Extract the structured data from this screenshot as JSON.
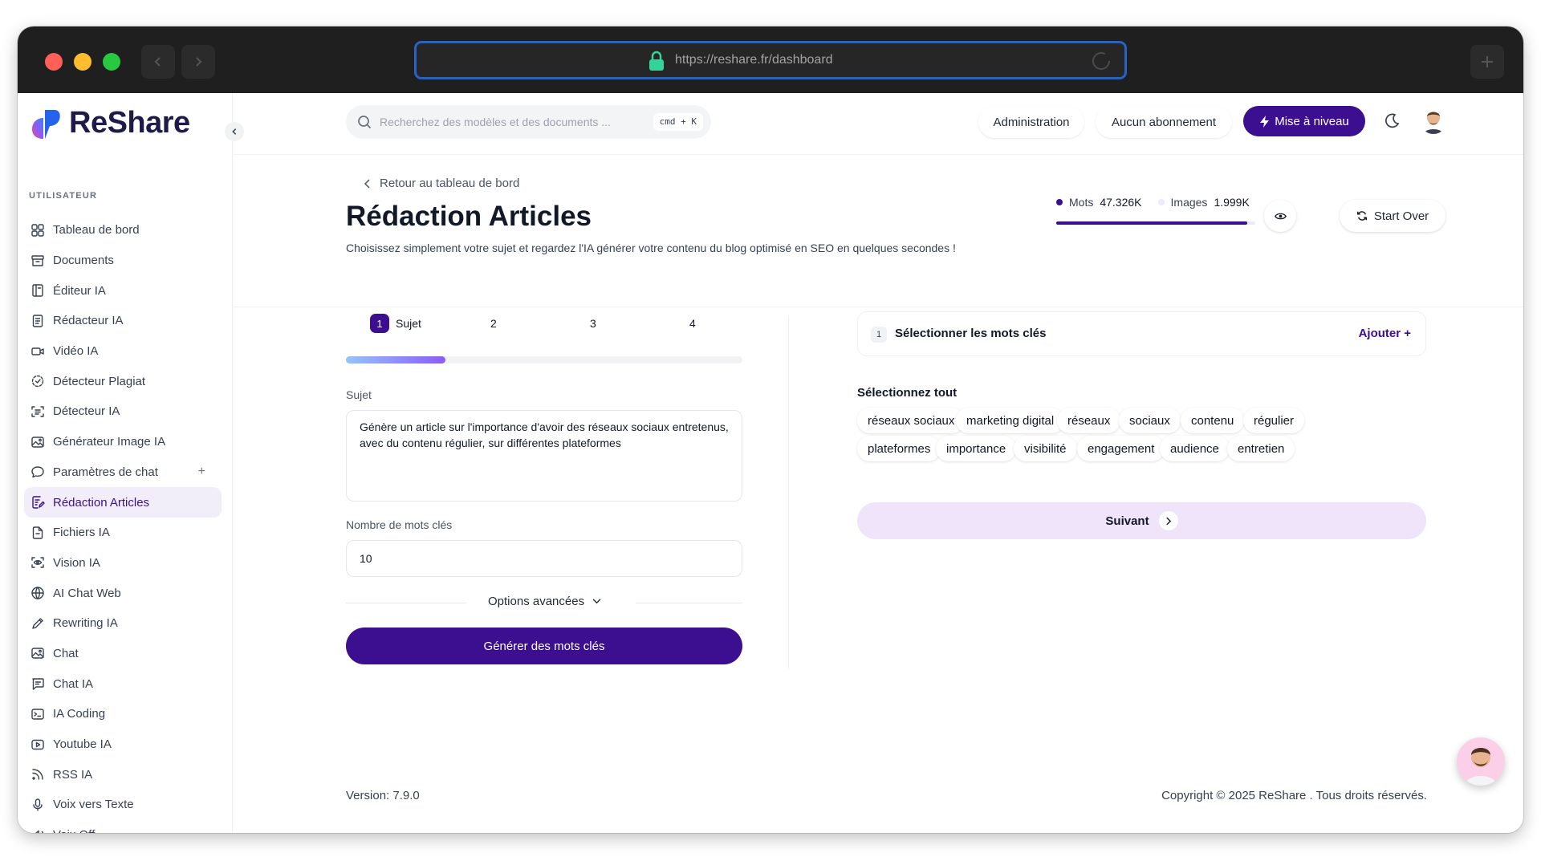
{
  "browser": {
    "url": "https://reshare.fr/dashboard"
  },
  "app": {
    "brand": "ReShare"
  },
  "sidebar": {
    "section_title": "UTILISATEUR",
    "items": [
      {
        "label": "Tableau de bord",
        "icon": "grid-icon"
      },
      {
        "label": "Documents",
        "icon": "archive-icon"
      },
      {
        "label": "Éditeur IA",
        "icon": "book-icon"
      },
      {
        "label": "Rédacteur IA",
        "icon": "document-icon"
      },
      {
        "label": "Vidéo IA",
        "icon": "video-icon"
      },
      {
        "label": "Détecteur Plagiat",
        "icon": "dashed-check-icon"
      },
      {
        "label": "Détecteur IA",
        "icon": "scan-icon"
      },
      {
        "label": "Générateur Image IA",
        "icon": "image-icon"
      },
      {
        "label": "Paramètres de chat",
        "icon": "chat-bubble-icon",
        "add": "+"
      },
      {
        "label": "Rédaction Articles",
        "icon": "article-edit-icon",
        "active": true
      },
      {
        "label": "Fichiers IA",
        "icon": "file-icon"
      },
      {
        "label": "Vision IA",
        "icon": "eye-scan-icon"
      },
      {
        "label": "AI Chat Web",
        "icon": "globe-icon"
      },
      {
        "label": "Rewriting IA",
        "icon": "pen-icon"
      },
      {
        "label": "Chat",
        "icon": "image-icon"
      },
      {
        "label": "Chat IA",
        "icon": "message-square-icon"
      },
      {
        "label": "IA Coding",
        "icon": "terminal-icon"
      },
      {
        "label": "Youtube IA",
        "icon": "play-icon"
      },
      {
        "label": "RSS IA",
        "icon": "rss-icon"
      },
      {
        "label": "Voix vers Texte",
        "icon": "mic-icon"
      },
      {
        "label": "Voix Off",
        "icon": "speaker-icon"
      }
    ]
  },
  "topbar": {
    "search_placeholder": "Recherchez des modèles et des documents ...",
    "shortcut": "cmd + K",
    "admin_label": "Administration",
    "subscription_label": "Aucun abonnement",
    "upgrade_label": "Mise à niveau"
  },
  "header": {
    "back_label": "Retour au tableau de bord",
    "title": "Rédaction Articles",
    "subtitle": "Choisissez simplement votre sujet et regardez l'IA générer votre contenu du blog optimisé en SEO en quelques secondes !",
    "stats": {
      "words_label": "Mots",
      "words_value": "47.326K",
      "images_label": "Images",
      "images_value": "1.999K",
      "usage_fraction": 0.96
    },
    "start_over_label": "Start Over"
  },
  "form": {
    "steps": [
      {
        "num": "1",
        "label": "Sujet"
      },
      {
        "num": "2",
        "label": ""
      },
      {
        "num": "3",
        "label": ""
      },
      {
        "num": "4",
        "label": ""
      }
    ],
    "progress_fraction": 0.25,
    "subject_label": "Sujet",
    "subject_value": "Génère un article sur l'importance d'avoir des réseaux sociaux entretenus, avec du contenu régulier, sur différentes plateformes",
    "keywords_count_label": "Nombre de mots clés",
    "keywords_count_value": "10",
    "advanced_label": "Options avancées",
    "generate_label": "Générer des mots clés"
  },
  "keywords": {
    "step_num": "1",
    "title": "Sélectionner les mots clés",
    "add_label": "Ajouter +",
    "select_all_label": "Sélectionnez tout",
    "chips": [
      "réseaux sociaux",
      "marketing digital",
      "réseaux",
      "sociaux",
      "contenu",
      "régulier",
      "plateformes",
      "importance",
      "visibilité",
      "engagement",
      "audience",
      "entretien"
    ],
    "next_label": "Suivant"
  },
  "footer": {
    "version": "Version: 7.9.0",
    "copyright": "Copyright © 2025 ReShare . Tous droits réservés."
  },
  "colors": {
    "accent": "#3b0f8f",
    "active_bg": "#f1eef9",
    "next_button_bg": "#f0e4fb"
  }
}
